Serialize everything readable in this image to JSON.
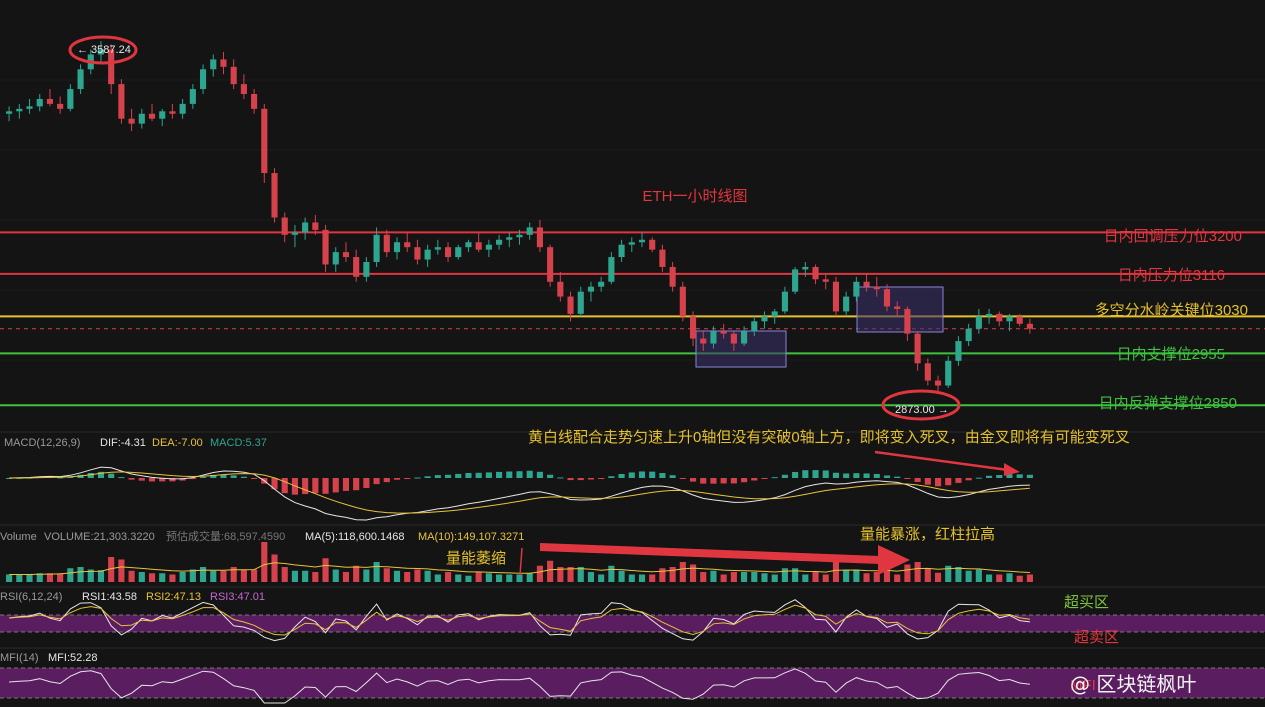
{
  "chart_data": {
    "type": "candlestick",
    "title": "ETH一小时线图",
    "price_range": [
      2800,
      3650
    ],
    "ohlc": [
      [
        3440,
        3455,
        3425,
        3445
      ],
      [
        3445,
        3460,
        3430,
        3450
      ],
      [
        3450,
        3470,
        3440,
        3455
      ],
      [
        3455,
        3480,
        3445,
        3470
      ],
      [
        3470,
        3490,
        3455,
        3460
      ],
      [
        3460,
        3475,
        3440,
        3450
      ],
      [
        3450,
        3500,
        3445,
        3490
      ],
      [
        3490,
        3540,
        3480,
        3530
      ],
      [
        3530,
        3570,
        3520,
        3560
      ],
      [
        3560,
        3587.24,
        3540,
        3570
      ],
      [
        3570,
        3580,
        3480,
        3500
      ],
      [
        3500,
        3510,
        3420,
        3430
      ],
      [
        3430,
        3450,
        3405,
        3420
      ],
      [
        3420,
        3450,
        3410,
        3440
      ],
      [
        3440,
        3460,
        3425,
        3430
      ],
      [
        3430,
        3450,
        3415,
        3445
      ],
      [
        3445,
        3460,
        3430,
        3440
      ],
      [
        3440,
        3470,
        3430,
        3460
      ],
      [
        3460,
        3500,
        3450,
        3490
      ],
      [
        3490,
        3540,
        3480,
        3530
      ],
      [
        3530,
        3560,
        3515,
        3550
      ],
      [
        3550,
        3565,
        3520,
        3535
      ],
      [
        3535,
        3550,
        3490,
        3500
      ],
      [
        3500,
        3520,
        3470,
        3480
      ],
      [
        3480,
        3490,
        3440,
        3450
      ],
      [
        3450,
        3460,
        3300,
        3320
      ],
      [
        3320,
        3330,
        3220,
        3230
      ],
      [
        3230,
        3240,
        3180,
        3195
      ],
      [
        3195,
        3215,
        3170,
        3200
      ],
      [
        3200,
        3230,
        3185,
        3220
      ],
      [
        3220,
        3235,
        3195,
        3205
      ],
      [
        3205,
        3215,
        3120,
        3135
      ],
      [
        3135,
        3170,
        3120,
        3160
      ],
      [
        3160,
        3180,
        3140,
        3150
      ],
      [
        3150,
        3165,
        3100,
        3110
      ],
      [
        3110,
        3150,
        3100,
        3140
      ],
      [
        3140,
        3210,
        3130,
        3195
      ],
      [
        3195,
        3205,
        3150,
        3160
      ],
      [
        3160,
        3190,
        3145,
        3180
      ],
      [
        3180,
        3200,
        3160,
        3170
      ],
      [
        3170,
        3185,
        3135,
        3145
      ],
      [
        3145,
        3175,
        3130,
        3165
      ],
      [
        3165,
        3185,
        3155,
        3170
      ],
      [
        3170,
        3180,
        3140,
        3150
      ],
      [
        3150,
        3175,
        3145,
        3170
      ],
      [
        3170,
        3185,
        3160,
        3180
      ],
      [
        3180,
        3200,
        3160,
        3165
      ],
      [
        3165,
        3185,
        3150,
        3175
      ],
      [
        3175,
        3195,
        3165,
        3185
      ],
      [
        3185,
        3200,
        3170,
        3190
      ],
      [
        3190,
        3205,
        3175,
        3195
      ],
      [
        3195,
        3220,
        3185,
        3210
      ],
      [
        3210,
        3225,
        3160,
        3170
      ],
      [
        3170,
        3175,
        3090,
        3100
      ],
      [
        3100,
        3120,
        3060,
        3070
      ],
      [
        3070,
        3080,
        3020,
        3035
      ],
      [
        3035,
        3090,
        3030,
        3080
      ],
      [
        3080,
        3100,
        3060,
        3090
      ],
      [
        3090,
        3110,
        3080,
        3100
      ],
      [
        3100,
        3160,
        3095,
        3150
      ],
      [
        3150,
        3185,
        3140,
        3175
      ],
      [
        3175,
        3190,
        3160,
        3180
      ],
      [
        3180,
        3200,
        3170,
        3185
      ],
      [
        3185,
        3190,
        3160,
        3165
      ],
      [
        3165,
        3175,
        3120,
        3130
      ],
      [
        3130,
        3140,
        3080,
        3090
      ],
      [
        3090,
        3100,
        3020,
        3030
      ],
      [
        3030,
        3040,
        2970,
        2985
      ],
      [
        2985,
        3000,
        2960,
        2975
      ],
      [
        2975,
        3010,
        2965,
        3000
      ],
      [
        3000,
        3015,
        2985,
        2995
      ],
      [
        2995,
        3000,
        2960,
        2975
      ],
      [
        2975,
        3010,
        2970,
        3000
      ],
      [
        3000,
        3030,
        2990,
        3020
      ],
      [
        3020,
        3040,
        3005,
        3030
      ],
      [
        3030,
        3045,
        3015,
        3040
      ],
      [
        3040,
        3090,
        3035,
        3080
      ],
      [
        3080,
        3130,
        3075,
        3125
      ],
      [
        3125,
        3140,
        3110,
        3130
      ],
      [
        3130,
        3135,
        3095,
        3105
      ],
      [
        3105,
        3115,
        3085,
        3100
      ],
      [
        3100,
        3110,
        3030,
        3040
      ],
      [
        3040,
        3080,
        3030,
        3070
      ],
      [
        3070,
        3110,
        3060,
        3100
      ],
      [
        3100,
        3115,
        3080,
        3090
      ],
      [
        3090,
        3110,
        3070,
        3085
      ],
      [
        3085,
        3095,
        3040,
        3050
      ],
      [
        3050,
        3060,
        3030,
        3045
      ],
      [
        3045,
        3050,
        2980,
        2995
      ],
      [
        2995,
        3000,
        2920,
        2935
      ],
      [
        2935,
        2945,
        2890,
        2900
      ],
      [
        2900,
        2910,
        2873,
        2890
      ],
      [
        2890,
        2950,
        2885,
        2940
      ],
      [
        2940,
        2990,
        2930,
        2980
      ],
      [
        2980,
        3015,
        2970,
        3005
      ],
      [
        3005,
        3045,
        2995,
        3030
      ],
      [
        3030,
        3045,
        3015,
        3035
      ],
      [
        3035,
        3040,
        3010,
        3020
      ],
      [
        3020,
        3035,
        3000,
        3030
      ],
      [
        3030,
        3035,
        3010,
        3015
      ],
      [
        3015,
        3025,
        2995,
        3005
      ]
    ],
    "annotations": {
      "high": "← 3587.24",
      "low": "2873.00 →",
      "box_left": "2873.00",
      "callout_macd": "黄白线配合走势匀速上升0轴但没有突破0轴上方，即将变入死叉，由金叉即将有可能变死叉",
      "callout_vol_low": "量能萎缩",
      "callout_vol_high": "量能暴涨，红柱拉高",
      "overbought": "超买区",
      "oversold": "超卖区"
    },
    "levels": [
      {
        "label": "日内回调压力位3200",
        "value": 3200,
        "color": "#e0363f"
      },
      {
        "label": "日内压力位3116",
        "value": 3116,
        "color": "#e0363f"
      },
      {
        "label": "多空分水岭关键位3030",
        "value": 3030,
        "color": "#e5c12e"
      },
      {
        "label": "日内支撑位2955",
        "value": 2955,
        "color": "#3ec23e"
      },
      {
        "label": "日内反弹支撑位2850",
        "value": 2850,
        "color": "#3ec23e"
      }
    ],
    "macd": {
      "header": "MACD(12,26,9)",
      "dif": "DIF:-4.31",
      "dea": "DEA:-7.00",
      "macd": "MACD:5.37"
    },
    "volume": {
      "header": "Volume",
      "vol": "VOLUME:21,303.3220",
      "pred": "预估成交量:68,597.4590",
      "ma5": "MA(5):118,600.1468",
      "ma10": "MA(10):149,107.3271"
    },
    "rsi": {
      "header": "RSI(6,12,24)",
      "rsi1": "RSI1:43.58",
      "rsi2": "RSI2:47.13",
      "rsi3": "RSI3:47.01"
    },
    "mfi": {
      "header": "MFI(14)",
      "mfi": "MFI:52.28",
      "mfi_label": "MFI"
    }
  },
  "colors": {
    "up": "#2ea58f",
    "down": "#d6424c",
    "macd_line": "#e6e6e6",
    "signal_line": "#e8c33a",
    "purple": "#5a1d60"
  },
  "watermark": "@ 区块链枫叶"
}
